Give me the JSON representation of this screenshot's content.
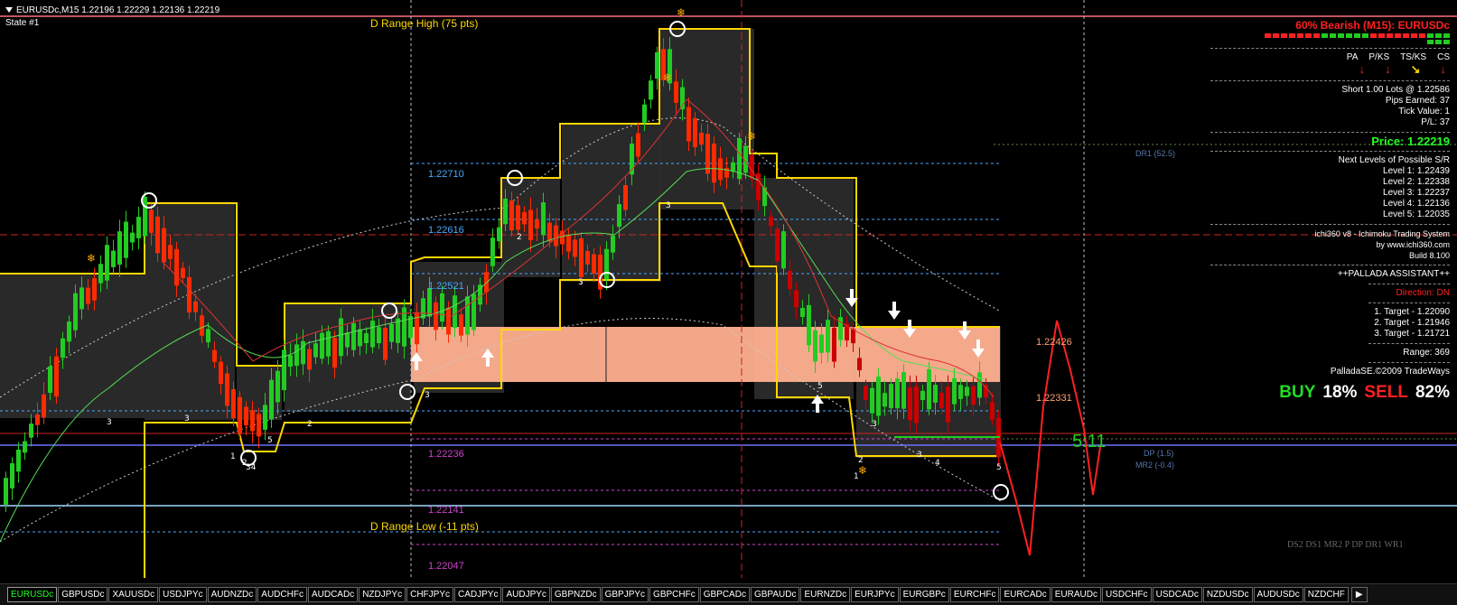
{
  "header": {
    "symbol_line": "EURUSDc,M15  1.22196 1.22229 1.22136 1.22219",
    "state": "State #1"
  },
  "chart_labels": {
    "d_range_high": "D Range High (75 pts)",
    "d_range_low": "D Range Low (-11 pts)",
    "levels": [
      "1.22710",
      "1.22616",
      "1.22521",
      "1.22426",
      "1.22331",
      "1.22236",
      "1.22141",
      "1.22047"
    ],
    "dr1": "DR1 (52.5)",
    "dp": "DP (1.5)",
    "mr2": "MR2 (-0.4)",
    "pivot_legend": "DS2 DS1 MR2 P DP DR1 WR1",
    "candle_timer": "5:11"
  },
  "panel": {
    "bias": "60% Bearish (M15): EURUSDc",
    "dots": [
      "#ff2020",
      "#ff2020",
      "#ff2020",
      "#ff2020",
      "#ff2020",
      "#ff2020",
      "#ff2020",
      "#22cc22",
      "#22cc22",
      "#22cc22",
      "#22cc22",
      "#22cc22",
      "#22cc22",
      "#ff2020",
      "#ff2020",
      "#ff2020",
      "#ff2020",
      "#ff2020",
      "#ff2020",
      "#ff2020",
      "#22cc22",
      "#22cc22",
      "#22cc22",
      "#22cc22",
      "#22cc22",
      "#22cc22"
    ],
    "indicators": [
      "PA",
      "P/KS",
      "TS/KS",
      "CS"
    ],
    "indicator_colors": [
      "#ff2020",
      "#ff2020",
      "#ffd700",
      "#ff2020"
    ],
    "indicator_icons": [
      "arrow-down-icon",
      "arrow-down-icon",
      "arrow-down-right-icon",
      "arrow-down-icon"
    ],
    "trade_line1": "Short 1.00 Lots @ 1.22586",
    "pips": "Pips Earned: 37",
    "tick_value": "Tick Value: 1",
    "pl": "P/L: 37",
    "price": "Price: 1.22219",
    "next_levels_title": "Next Levels of Possible S/R",
    "levels": [
      "Level 1: 1.22439",
      "Level 2: 1.22338",
      "Level 3: 1.22237",
      "Level 4: 1.22136",
      "Level 5: 1.22035"
    ],
    "brand1": "ichi360 v8 - Ichimoku Trading System",
    "brand2": "by www.ichi360.com",
    "build": "Build 8.100",
    "assistant": "++PALLADA ASSISTANT++",
    "direction": "Direction: DN",
    "targets": [
      "1. Target - 1.22090",
      "2. Target - 1.21946",
      "3. Target - 1.21721"
    ],
    "range": "Range: 369",
    "copyright": "PalladaSE.©2009 TradeWays",
    "buy_label": "BUY",
    "buy_pct": "18%",
    "sell_label": "SELL",
    "sell_pct": "82%"
  },
  "tabs": [
    "EURUSDc",
    "GBPUSDc",
    "XAUUSDc",
    "USDJPYc",
    "AUDNZDc",
    "AUDCHFc",
    "AUDCADc",
    "NZDJPYc",
    "CHFJPYc",
    "CADJPYc",
    "AUDJPYc",
    "GBPNZDc",
    "GBPJPYc",
    "GBPCHFc",
    "GBPCADc",
    "GBPAUDc",
    "EURNZDc",
    "EURJPYc",
    "EURGBPc",
    "EURCHFc",
    "EURCADc",
    "EURAUDc",
    "USDCHFc",
    "USDCADc",
    "NZDUSDc",
    "AUDUSDc",
    "NZDCHF"
  ],
  "active_tab": "EURUSDc",
  "colors": {
    "bull": "#22cc22",
    "bear": "#ff2a00",
    "bear_dark": "#cc0000",
    "range": "#ffd700",
    "zone": "#ffb090",
    "box": "#2e2e2e"
  }
}
